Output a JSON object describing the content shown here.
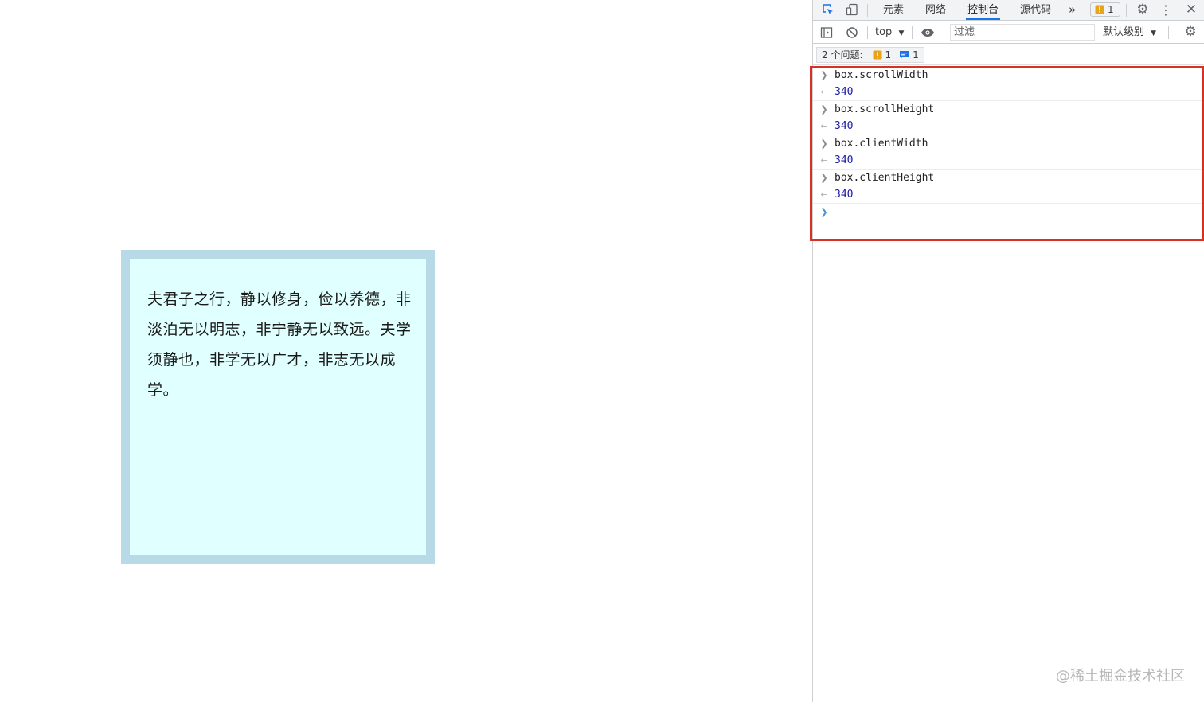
{
  "page": {
    "paragraph": "夫君子之行，静以修身，俭以养德，非淡泊无以明志，非宁静无以致远。夫学须静也，非学无以广才，非志无以成学。"
  },
  "devtools": {
    "tabs": [
      {
        "label": "元素"
      },
      {
        "label": "网络"
      },
      {
        "label": "控制台"
      },
      {
        "label": "源代码"
      }
    ],
    "more_tabs": "»",
    "issues_badge_count": "1",
    "toolbar": {
      "context": "top",
      "filter_placeholder": "过滤",
      "level": "默认级别"
    },
    "issues_bar": {
      "label": "2 个问题:",
      "warning_count": "1",
      "info_count": "1"
    },
    "console": [
      {
        "input": "box.scrollWidth",
        "output": "340"
      },
      {
        "input": "box.scrollHeight",
        "output": "340"
      },
      {
        "input": "box.clientWidth",
        "output": "340"
      },
      {
        "input": "box.clientHeight",
        "output": "340"
      }
    ]
  },
  "watermark": "@稀土掘金技术社区",
  "colors": {
    "box_border": "#b8d9e6",
    "box_bg": "#e0ffff",
    "highlight": "#d93025",
    "active_tab": "#1a73e8",
    "result_text": "#1a1aa6"
  }
}
